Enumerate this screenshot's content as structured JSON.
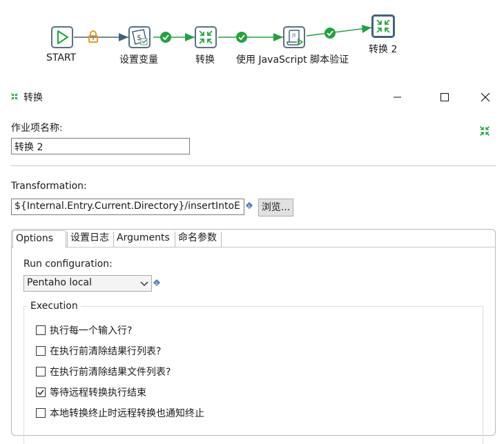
{
  "flow": {
    "nodes": [
      {
        "label": "START",
        "icon": "play-icon"
      },
      {
        "label": "设置变量",
        "icon": "set-variables-icon"
      },
      {
        "label": "转换",
        "icon": "transformation-icon"
      },
      {
        "label": "使用 JavaScript 脚本验证",
        "icon": "javascript-icon"
      },
      {
        "label": "转换 2",
        "icon": "transformation-icon"
      }
    ],
    "colors": {
      "hop_ok": "#1fa33a",
      "hop_unconditional": "#e89a25",
      "hop_line": "#43607a",
      "node_border": "#5a7081",
      "icon_green": "#1fa33a"
    }
  },
  "dialog": {
    "title": "转换",
    "job_entry_name_label": "作业项名称:",
    "job_entry_name_value": "转换 2",
    "transformation_label": "Transformation:",
    "transformation_path": "${Internal.Entry.Current.Directory}/insertIntoE",
    "browse_label": "浏览...",
    "tabs": [
      "Options",
      "设置日志",
      "Arguments",
      "命名参数"
    ],
    "active_tab": "Options",
    "run_configuration_label": "Run configuration:",
    "run_configuration_value": "Pentaho local",
    "execution_title": "Execution",
    "execution_options": [
      {
        "label": "执行每一个输入行?",
        "checked": false
      },
      {
        "label": "在执行前清除结果行列表?",
        "checked": false
      },
      {
        "label": "在执行前清除结果文件列表?",
        "checked": false
      },
      {
        "label": "等待远程转换执行结束",
        "checked": true
      },
      {
        "label": "本地转换终止时远程转换也通知终止",
        "checked": false
      }
    ]
  }
}
